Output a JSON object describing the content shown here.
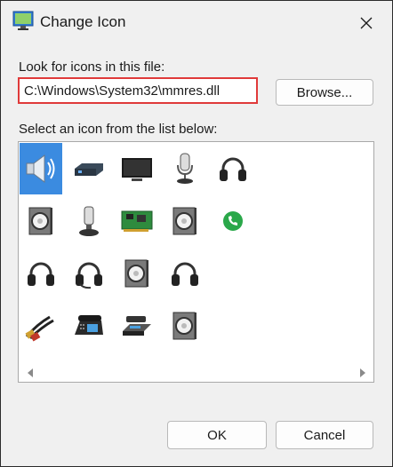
{
  "window": {
    "title": "Change Icon",
    "close_glyph": "✕"
  },
  "file_label": "Look for icons in this file:",
  "file_path": "C:\\Windows\\System32\\mmres.dll",
  "browse_label": "Browse...",
  "list_label": "Select an icon from the list below:",
  "icons": [
    "speaker-icon",
    "audio-device-icon",
    "monitor-icon",
    "microphone-icon",
    "headphones-icon",
    "speaker-box-icon",
    "headset-mic-icon",
    "sound-card-icon",
    "speaker-box-icon",
    "phone-green-icon",
    "headphones-icon",
    "headset-icon",
    "speaker-box-icon",
    "headphones-icon",
    "audio-cable-icon",
    "telephone-icon",
    "hdmi-device-icon",
    "speaker-box-icon"
  ],
  "ok_label": "OK",
  "cancel_label": "Cancel",
  "colors": {
    "highlight": "#e03a3a",
    "selection": "#3b8be0"
  }
}
